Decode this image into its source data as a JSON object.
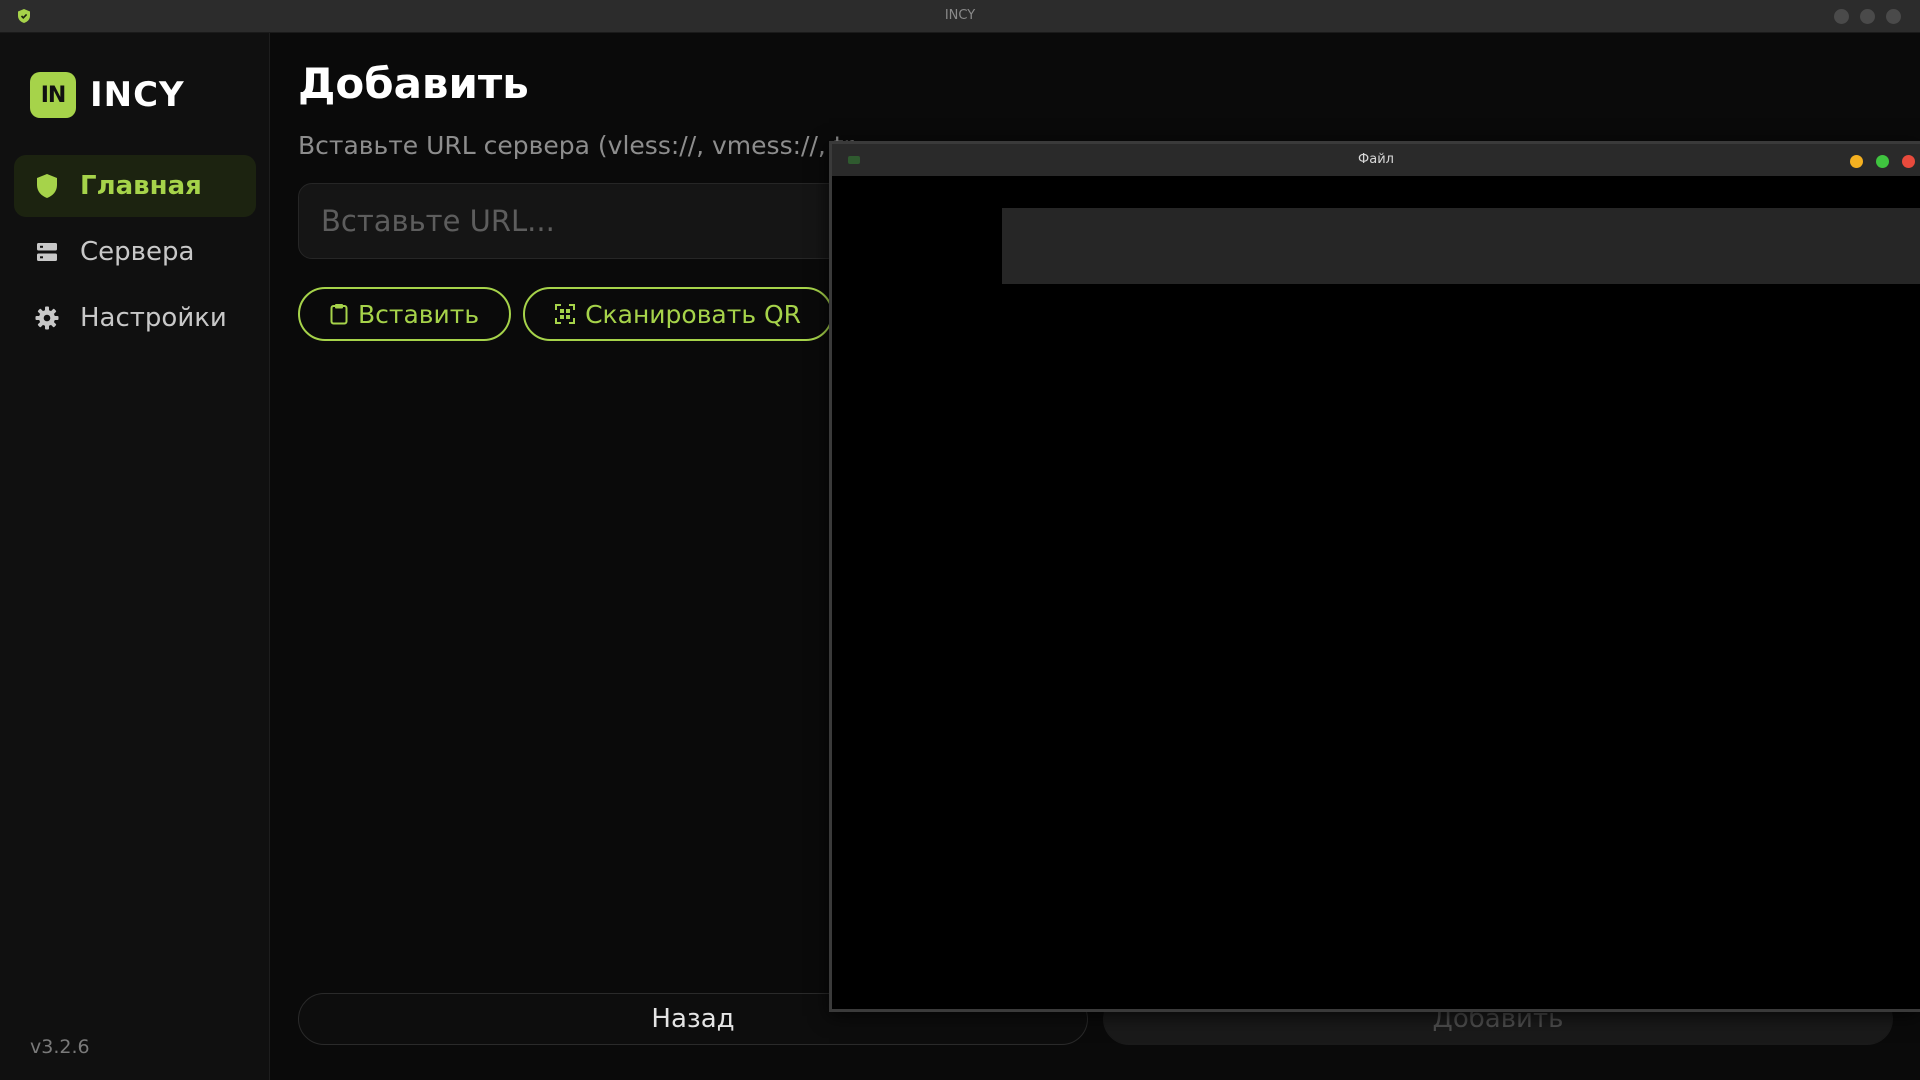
{
  "window": {
    "title": "INCY",
    "app_icon": "shield-icon"
  },
  "sidebar": {
    "brand_badge": "IN",
    "brand_name": "INCY",
    "items": [
      {
        "label": "Главная",
        "icon": "shield-icon",
        "active": true
      },
      {
        "label": "Сервера",
        "icon": "server-icon",
        "active": false
      },
      {
        "label": "Настройки",
        "icon": "gear-icon",
        "active": false
      }
    ],
    "version": "v3.2.6"
  },
  "main": {
    "title": "Добавить",
    "subtitle": "Вставьте URL сервера (vless://, vmess://, tr",
    "url_input": {
      "value": "",
      "placeholder": "Вставьте URL..."
    },
    "paste_button": "Вставить",
    "scan_button": "Сканировать QR",
    "back_button": "Назад",
    "add_button": "Добавить"
  },
  "file_dialog": {
    "title": "Файл"
  },
  "colors": {
    "accent": "#a6d34a",
    "background": "#0a0a0a",
    "sidebar": "#101010",
    "active_bg": "#1c2310",
    "dot_minimize": "#f4b020",
    "dot_maximize": "#3fc43f",
    "dot_close": "#e84a3c"
  }
}
